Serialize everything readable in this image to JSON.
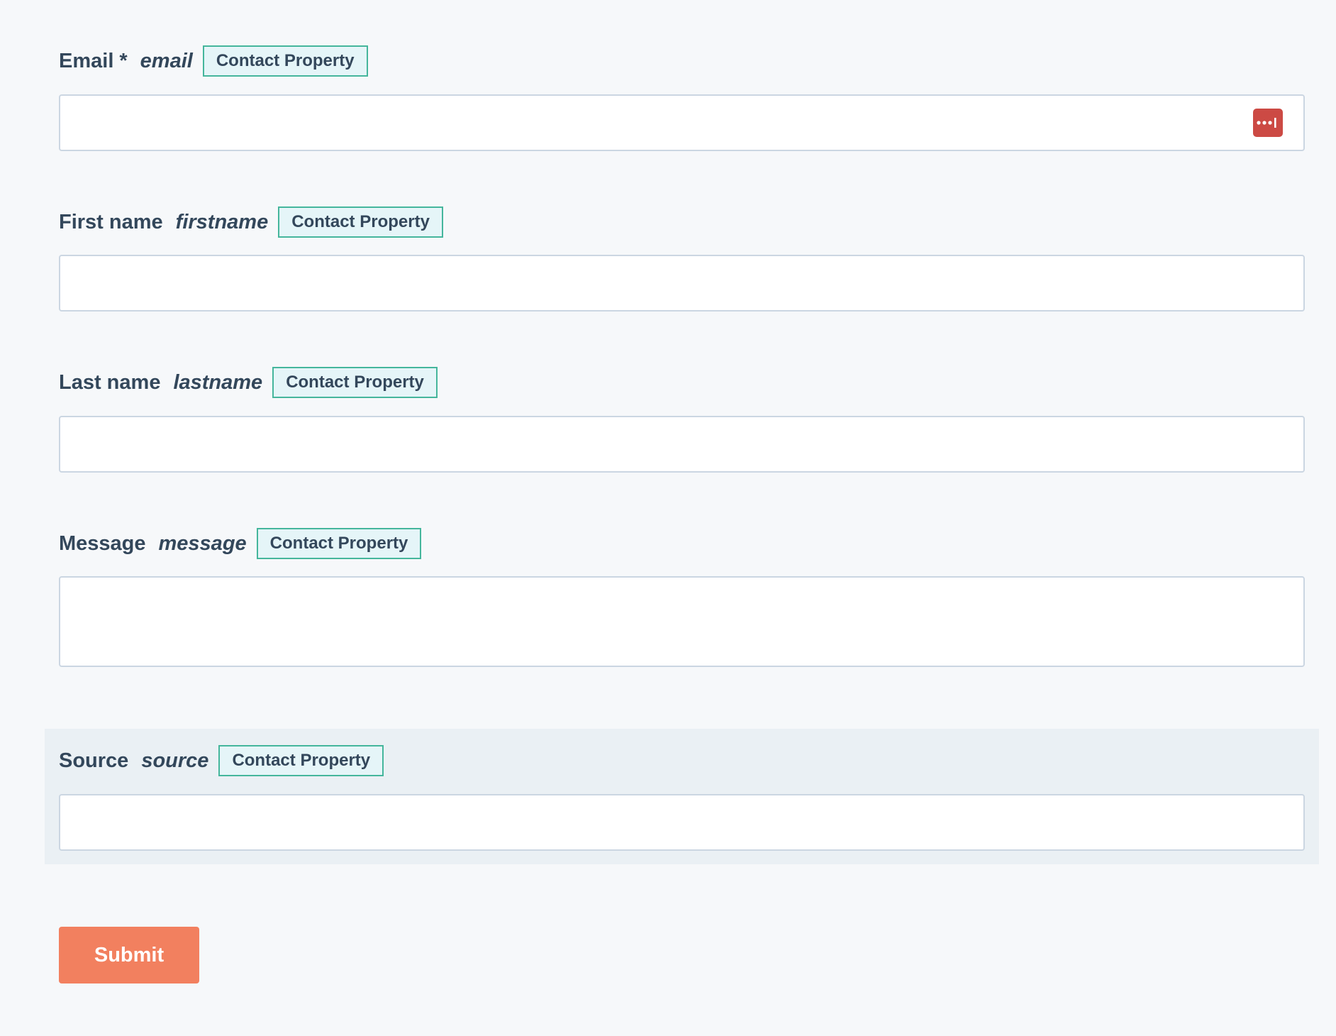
{
  "form": {
    "property_badge": "Contact Property",
    "fields": [
      {
        "label": "Email",
        "required_marker": "*",
        "internal_name": "email",
        "value": ""
      },
      {
        "label": "First name",
        "internal_name": "firstname",
        "value": ""
      },
      {
        "label": "Last name",
        "internal_name": "lastname",
        "value": ""
      },
      {
        "label": "Message",
        "internal_name": "message",
        "value": ""
      },
      {
        "label": "Source",
        "internal_name": "source",
        "value": ""
      }
    ],
    "submit_label": "Submit"
  },
  "colors": {
    "accent_submit": "#f2805f",
    "badge_border": "#45b69c",
    "badge_bg": "#e5f5f8",
    "password_manager_icon": "#cc4a44"
  },
  "icons": {
    "email_field_icon": "password-manager-icon"
  }
}
